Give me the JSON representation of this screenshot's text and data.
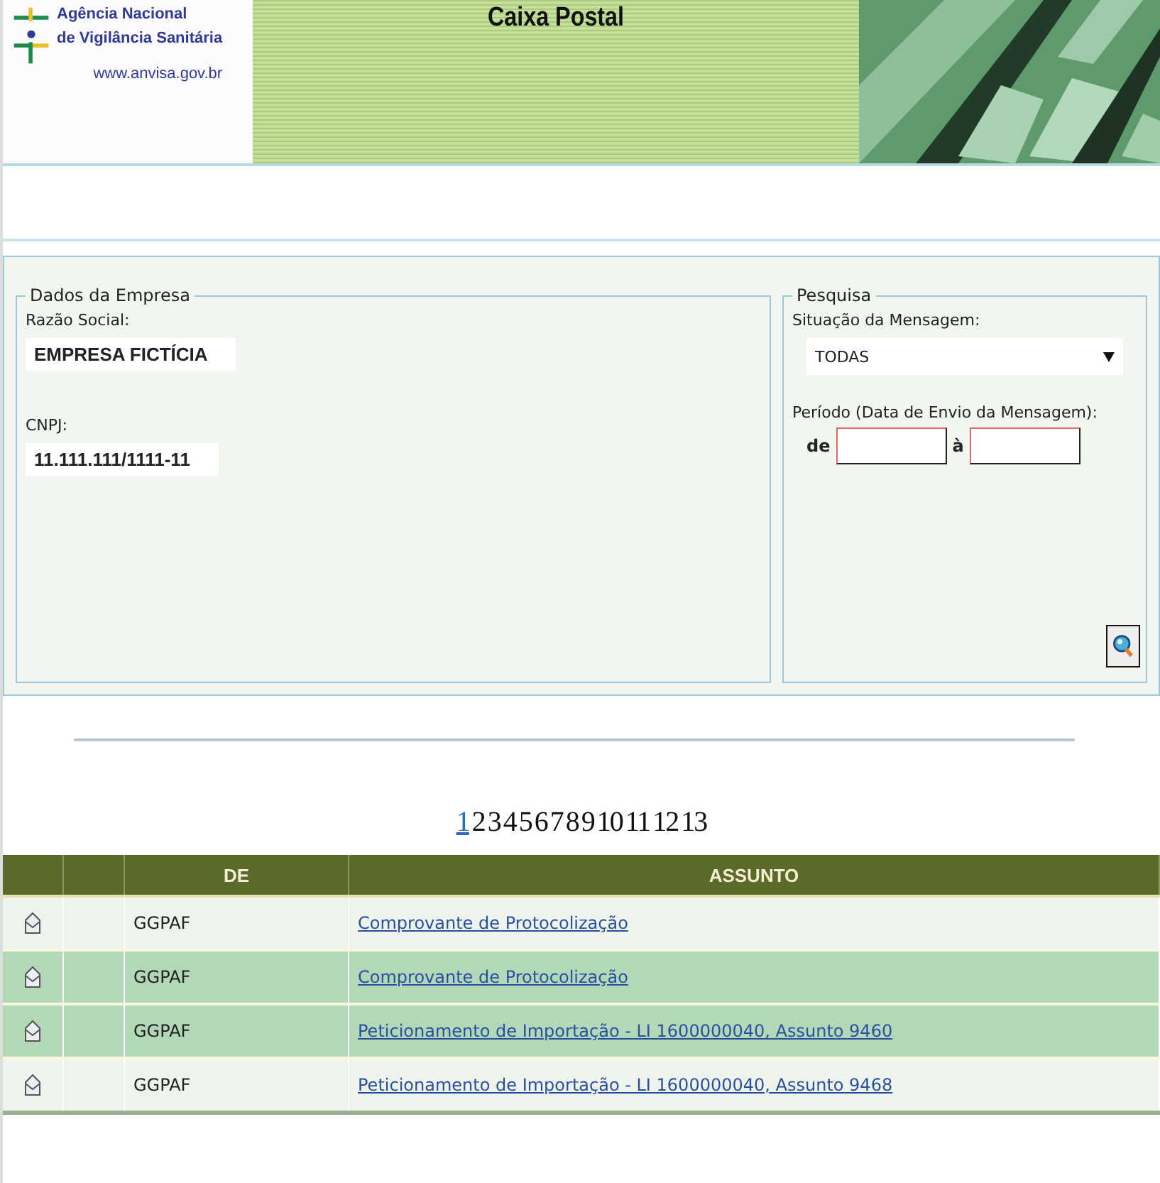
{
  "header": {
    "agency_line_1": "Agência Nacional",
    "agency_line_2": "de Vigilância Sanitária",
    "website": "www.anvisa.gov.br",
    "title": "Caixa Postal"
  },
  "company": {
    "legend": "Dados da Empresa",
    "name_label": "Razão Social:",
    "name_value": "EMPRESA FICTÍCIA",
    "cnpj_label": "CNPJ:",
    "cnpj_value": "11.111.111/1111-11"
  },
  "search": {
    "legend": "Pesquisa",
    "status_label": "Situação da Mensagem:",
    "status_value": "TODAS",
    "period_label": "Período (Data de Envio da Mensagem):",
    "from_label": "de",
    "to_label": "à"
  },
  "pages": [
    {
      "label": "1",
      "selected": true
    },
    {
      "label": "2",
      "selected": false
    },
    {
      "label": "3",
      "selected": false
    },
    {
      "label": "4",
      "selected": false
    },
    {
      "label": "5",
      "selected": false
    },
    {
      "label": "6",
      "selected": false
    },
    {
      "label": "7",
      "selected": false
    },
    {
      "label": "8",
      "selected": false
    },
    {
      "label": "9",
      "selected": false
    },
    {
      "label": "10",
      "selected": false
    },
    {
      "label": "11",
      "selected": false
    },
    {
      "label": "12",
      "selected": false
    },
    {
      "label": "13",
      "selected": false
    }
  ],
  "table": {
    "columns": [
      "DE",
      "ASSUNTO"
    ],
    "rows": [
      {
        "from": "GGPAF",
        "subject": "Comprovante de Protocolização",
        "selected": false
      },
      {
        "from": "GGPAF",
        "subject": "Comprovante de Protocolização",
        "selected": true
      },
      {
        "from": "GGPAF",
        "subject": "Peticionamento de Importação - LI 1600000040, Assunto 9460",
        "selected": true
      },
      {
        "from": "GGPAF",
        "subject": "Peticionamento de Importação - LI 1600000040, Assunto 9468",
        "selected": false
      }
    ]
  }
}
